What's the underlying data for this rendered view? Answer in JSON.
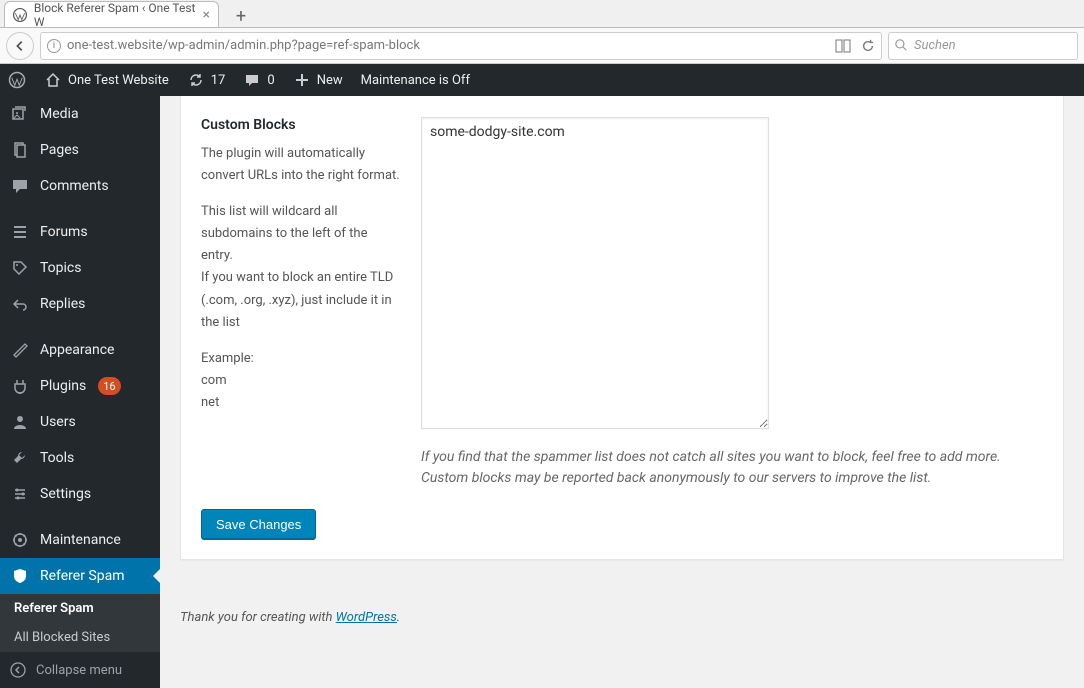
{
  "browser": {
    "tab_title": "Block Referer Spam ‹ One Test W",
    "url": "one-test.website/wp-admin/admin.php?page=ref-spam-block",
    "search_placeholder": "Suchen"
  },
  "adminbar": {
    "site_name": "One Test Website",
    "updates": "17",
    "comments": "0",
    "new_label": "New",
    "maintenance": "Maintenance is Off"
  },
  "sidebar": {
    "media": "Media",
    "pages": "Pages",
    "comments": "Comments",
    "forums": "Forums",
    "topics": "Topics",
    "replies": "Replies",
    "appearance": "Appearance",
    "plugins": "Plugins",
    "plugins_badge": "16",
    "users": "Users",
    "tools": "Tools",
    "settings": "Settings",
    "maintenance": "Maintenance",
    "referer_spam": "Referer Spam",
    "submenu": {
      "referer_spam": "Referer Spam",
      "all_blocked": "All Blocked Sites"
    },
    "collapse": "Collapse menu"
  },
  "form": {
    "heading": "Custom Blocks",
    "desc1": "The plugin will automatically convert URLs into the right format.",
    "desc2": "This list will wildcard all subdomains to the left of the entry.\nIf you want to block an entire TLD (.com, .org, .xyz), just include it in the list",
    "example_label": "Example:",
    "example1": "com",
    "example2": "net",
    "textarea_value": "some-dodgy-site.com",
    "hint": "If you find that the spammer list does not catch all sites you want to block, feel free to add more. Custom blocks may be reported back anonymously to our servers to improve the list.",
    "save": "Save Changes"
  },
  "footer": {
    "text": "Thank you for creating with ",
    "link": "WordPress",
    "period": "."
  }
}
